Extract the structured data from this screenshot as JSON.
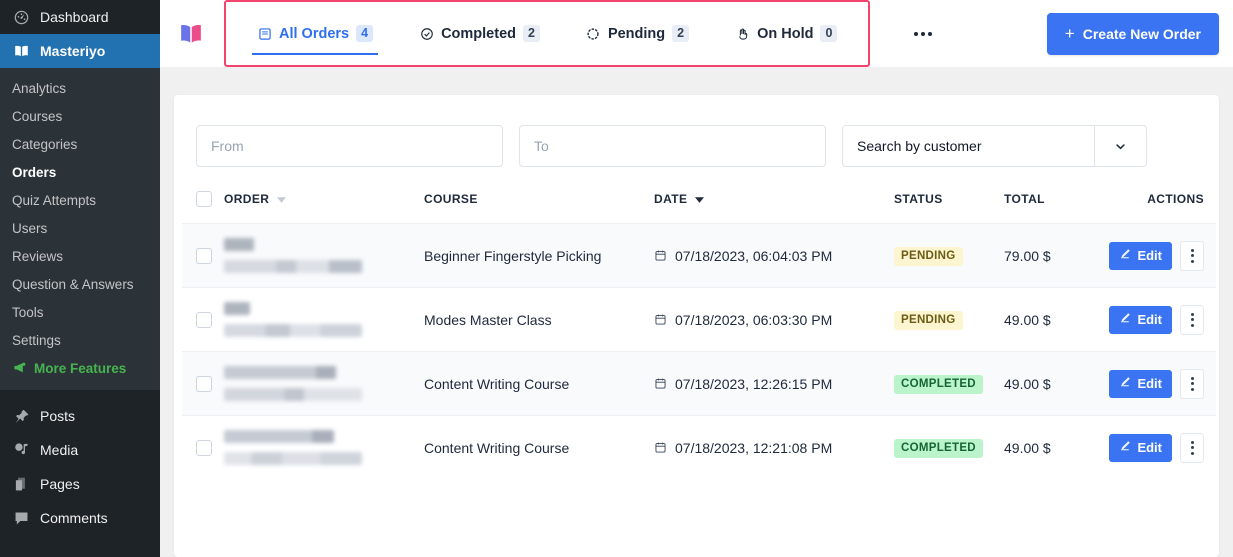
{
  "sidebar": {
    "top_items": [
      {
        "label": "Dashboard",
        "icon": "dashboard-icon",
        "active": false
      },
      {
        "label": "Masteriyo",
        "icon": "book-icon",
        "active": true
      }
    ],
    "submenu": [
      {
        "label": "Analytics",
        "current": false
      },
      {
        "label": "Courses",
        "current": false
      },
      {
        "label": "Categories",
        "current": false
      },
      {
        "label": "Orders",
        "current": true
      },
      {
        "label": "Quiz Attempts",
        "current": false
      },
      {
        "label": "Users",
        "current": false
      },
      {
        "label": "Reviews",
        "current": false
      },
      {
        "label": "Question & Answers",
        "current": false
      },
      {
        "label": "Tools",
        "current": false
      },
      {
        "label": "Settings",
        "current": false
      },
      {
        "label": "More Features",
        "current": false,
        "feature": true,
        "icon": "megaphone-icon"
      }
    ],
    "bottom_items": [
      {
        "label": "Posts",
        "icon": "pin-icon"
      },
      {
        "label": "Media",
        "icon": "media-icon"
      },
      {
        "label": "Pages",
        "icon": "pages-icon"
      },
      {
        "label": "Comments",
        "icon": "comment-icon"
      }
    ]
  },
  "header": {
    "logo": "masteriyo-book-logo",
    "tabs": [
      {
        "label": "All Orders",
        "count": "4",
        "icon": "list-icon",
        "active": true
      },
      {
        "label": "Completed",
        "count": "2",
        "icon": "check-circle-icon",
        "active": false
      },
      {
        "label": "Pending",
        "count": "2",
        "icon": "dotted-circle-icon",
        "active": false
      },
      {
        "label": "On Hold",
        "count": "0",
        "icon": "hand-icon",
        "active": false
      }
    ],
    "more_menu": "more-options",
    "create_button": "Create New Order",
    "highlight_color": "#f4436c",
    "accent_color": "#3b74f2"
  },
  "filters": {
    "from_placeholder": "From",
    "from_value": "",
    "to_placeholder": "To",
    "to_value": "",
    "customer_select_value": "Search by customer"
  },
  "table": {
    "columns": [
      "ORDER",
      "COURSE",
      "DATE",
      "STATUS",
      "TOTAL",
      "ACTIONS"
    ],
    "sort": {
      "order": "sort-desc-icon",
      "date": "sort-desc-icon-active"
    },
    "rows": [
      {
        "order_redacted": true,
        "course": "Beginner Fingerstyle Picking",
        "date": "07/18/2023, 06:04:03 PM",
        "status": "PENDING",
        "status_kind": "pending",
        "total": "79.00 $",
        "edit_label": "Edit"
      },
      {
        "order_redacted": true,
        "course": "Modes Master Class",
        "date": "07/18/2023, 06:03:30 PM",
        "status": "PENDING",
        "status_kind": "pending",
        "total": "49.00 $",
        "edit_label": "Edit"
      },
      {
        "order_redacted": true,
        "course": "Content Writing Course",
        "date": "07/18/2023, 12:26:15 PM",
        "status": "COMPLETED",
        "status_kind": "completed",
        "total": "49.00 $",
        "edit_label": "Edit"
      },
      {
        "order_redacted": true,
        "course": "Content Writing Course",
        "date": "07/18/2023, 12:21:08 PM",
        "status": "COMPLETED",
        "status_kind": "completed",
        "total": "49.00 $",
        "edit_label": "Edit"
      }
    ]
  }
}
